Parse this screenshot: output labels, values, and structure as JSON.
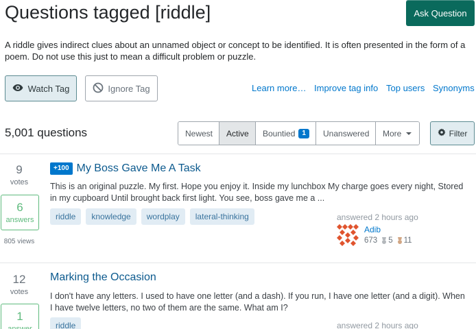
{
  "header": {
    "title": "Questions tagged [riddle]",
    "ask_label": "Ask Question"
  },
  "tag_description": "A riddle gives indirect clues about an unnamed object or concept to be identified. It is often presented in the form of a poem. Do not use this just to mean a difficult problem or puzzle.",
  "actions": {
    "watch_label": "Watch Tag",
    "ignore_label": "Ignore Tag"
  },
  "links": {
    "learn_more": "Learn more…",
    "improve": "Improve tag info",
    "top_users": "Top users",
    "synonyms": "Synonyms"
  },
  "question_count": "5,001 questions",
  "tabs": [
    {
      "label": "Newest"
    },
    {
      "label": "Active"
    },
    {
      "label": "Bountied",
      "badge": "1"
    },
    {
      "label": "Unanswered"
    },
    {
      "label": "More"
    }
  ],
  "filter_label": "Filter",
  "colors": {
    "accent": "#0077cc",
    "ask_button": "#0a6a5c",
    "answered_green": "#5eba7d"
  },
  "questions": [
    {
      "votes": "9",
      "votes_label": "votes",
      "answers": "6",
      "answers_label": "answers",
      "views": "805 views",
      "bounty": "+100",
      "title": "My Boss Gave Me A Task",
      "excerpt": "This is an original puzzle. My first. Hope you enjoy it. Inside my lunchbox My charge goes every night, Stored in my cupboard Until brought back first light. You see, boss gave me a ...",
      "tags": [
        "riddle",
        "knowledge",
        "wordplay",
        "lateral-thinking"
      ],
      "activity": "answered 2 hours ago",
      "user": {
        "name": "Adib",
        "reputation": "673",
        "silver": "5",
        "bronze": "11"
      }
    },
    {
      "votes": "12",
      "votes_label": "votes",
      "answers": "1",
      "answers_label": "answer",
      "title": "Marking the Occasion",
      "excerpt": "I don't have any letters. I used to have one letter (and a dash). If you run, I have one letter (and a digit). When I have twelve letters, no two of them are the same. What am I?",
      "tags": [
        "riddle"
      ],
      "activity": "answered 2 hours ago"
    }
  ]
}
